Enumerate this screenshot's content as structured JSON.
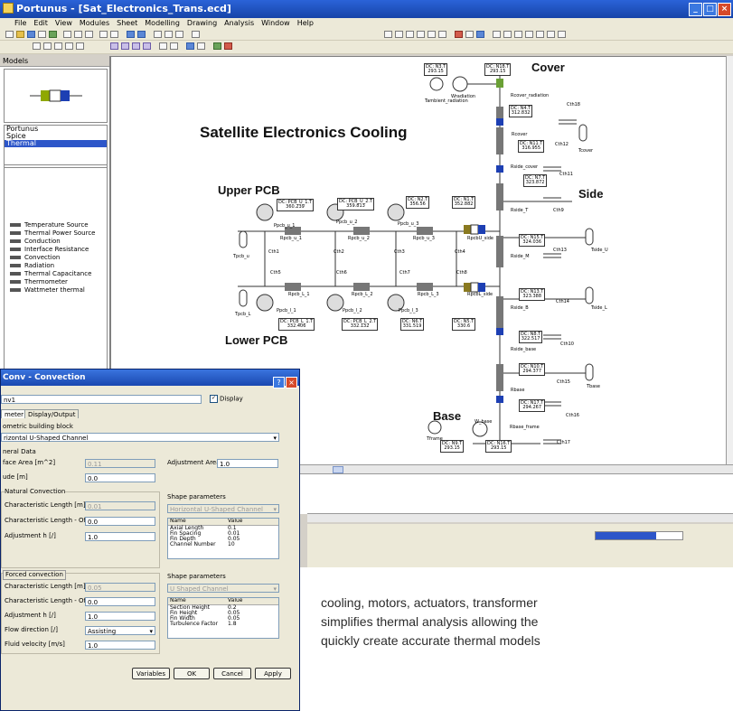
{
  "window": {
    "title": "Portunus - [Sat_Electronics_Trans.ecd]",
    "menus": [
      "File",
      "Edit",
      "View",
      "Modules",
      "Sheet",
      "Modelling",
      "Drawing",
      "Analysis",
      "Window",
      "Help"
    ]
  },
  "models_panel": {
    "header": "Models",
    "library": [
      "Portunus",
      "Spice",
      "Thermal"
    ],
    "selected_library": "Thermal",
    "elements": [
      "Temperature Source",
      "Thermal Power Source",
      "Conduction",
      "Interface Resistance",
      "Convection",
      "Radiation",
      "Thermal Capacitance",
      "Thermometer",
      "Wattmeter thermal"
    ]
  },
  "schematic": {
    "title": "Satellite Electronics Cooling",
    "sections": {
      "cover": "Cover",
      "side": "Side",
      "base": "Base",
      "upper_pcb": "Upper PCB",
      "lower_pcb": "Lower PCB"
    },
    "dc_boxes": [
      {
        "name": "DC: N3.T",
        "value": "293.15"
      },
      {
        "name": "DC: N18.T",
        "value": "293.15"
      },
      {
        "name": "DC: N4.T",
        "value": "312.832"
      },
      {
        "name": "DC: N11.T",
        "value": "316.955"
      },
      {
        "name": "DC: N7.T",
        "value": "323.872"
      },
      {
        "name": "DC: PCB_U_1.T",
        "value": "360.239"
      },
      {
        "name": "DC: PCB_U_2.T",
        "value": "359.813"
      },
      {
        "name": "DC: N2.T",
        "value": "356.56"
      },
      {
        "name": "DC: N1.T",
        "value": "352.882"
      },
      {
        "name": "DC: N15.T",
        "value": "324.036"
      },
      {
        "name": "DC: N13.T",
        "value": "323.388"
      },
      {
        "name": "DC: PCB_L_1.T",
        "value": "332.406"
      },
      {
        "name": "DC: PCB_L_2.T",
        "value": "332.132"
      },
      {
        "name": "DC: N6.T",
        "value": "331.519"
      },
      {
        "name": "DC: N5.T",
        "value": "330.6"
      },
      {
        "name": "DC: N8.T",
        "value": "322.517"
      },
      {
        "name": "DC: N10.T",
        "value": "294.377"
      },
      {
        "name": "DC: N17.T",
        "value": "294.267"
      },
      {
        "name": "DC: N9.T",
        "value": "293.15"
      },
      {
        "name": "DC: N16.T",
        "value": "293.15"
      }
    ],
    "component_labels": {
      "tambient": "Tambient_radiation",
      "wradiation": "Wradiation",
      "rcover_rad": "Rcover_radiation",
      "cth18": "Cth18",
      "rcover": "Rcover",
      "cth12": "Cth12",
      "tcover": "Tcover",
      "rside_cover": "Rside_cover",
      "cth11": "Cth11",
      "cth9": "Cth9",
      "rside_t": "Rside_T",
      "rside_m": "Rside_M",
      "cth13": "Cth13",
      "tside_u": "Tside_U",
      "cth14": "Cth14",
      "tside_l": "Tside_L",
      "rside_b": "Rside_B",
      "cth10": "Cth10",
      "rside_base": "Rside_base",
      "cth15": "Cth15",
      "tbase": "Tbase",
      "rbase": "Rbase",
      "cth16": "Cth16",
      "rbase_frame": "Rbase_frame",
      "cth17": "Cth17",
      "tframe": "Tframe",
      "w_base": "W_base",
      "ppcb_u_1": "Ppcb_u_1",
      "ppcb_u_2": "Ppcb_u_2",
      "ppcb_u_3": "Ppcb_u_3",
      "rpcb_u_1": "Rpcb_u_1",
      "rpcb_u_2": "Rpcb_u_2",
      "rpcb_u_3": "Rpcb_u_3",
      "rpcbu_side": "RpcbU_side",
      "tpcb_u": "Tpcb_u",
      "cth1": "Cth1",
      "cth2": "Cth2",
      "cth3": "Cth3",
      "cth4": "Cth4",
      "cth5": "Cth5",
      "cth6": "Cth6",
      "cth7": "Cth7",
      "cth8": "Cth8",
      "rpcb_l_1": "Rpcb_L_1",
      "rpcb_l_2": "Rpcb_L_2",
      "rpcb_l_3": "Rpcb_L_3",
      "rpcbl_side": "RpcbL_side",
      "tpcb_l": "Tpcb_L",
      "ppcb_l_1": "Ppcb_l_1",
      "ppcb_l_2": "Ppcb_l_2",
      "ppcb_l_3": "Ppcb_l_3"
    }
  },
  "dialog": {
    "title": "Conv - Convection",
    "name_value": "nv1",
    "display_label": "Display",
    "display_checked": true,
    "tabs": [
      "meter",
      "Display/Output"
    ],
    "building_block_label": "ometric building block",
    "building_block_value": "rizontal U-Shaped Channel",
    "general_data_label": "neral Data",
    "surface_area_label": "face Area [m^2]",
    "surface_area_value": "0.11",
    "adjustment_area_label": "Adjustment Area [/]",
    "adjustment_area_value": "1.0",
    "altitude_label": "ude [m]",
    "altitude_value": "0.0",
    "natural": {
      "label": "Natural Convection",
      "char_length_label": "Characteristic Length [m]",
      "char_length_value": "0.01",
      "char_offset_label": "Characteristic Length - Offset [m]",
      "char_offset_value": "0.0",
      "adjustment_label": "Adjustment h [/]",
      "adjustment_value": "1.0",
      "shape_label": "Shape parameters",
      "shape_select": "Horizontal U-Shaped Channel",
      "table_headers": [
        "Name",
        "Value"
      ],
      "rows": [
        [
          "Axial Length",
          "0.1"
        ],
        [
          "Fin Spacing",
          "0.01"
        ],
        [
          "Fin Depth",
          "0.05"
        ],
        [
          "Channel Number",
          "10"
        ]
      ]
    },
    "forced": {
      "label": "Forced convection",
      "char_length_label": "Characteristic Length [m]",
      "char_length_value": "0.05",
      "char_offset_label": "Characteristic Length - Offset [m]",
      "char_offset_value": "0.0",
      "adjustment_label": "Adjustment h [/]",
      "adjustment_value": "1.0",
      "flow_label": "Flow direction [/]",
      "flow_value": "Assisting",
      "velocity_label": "Fluid velocity [m/s]",
      "velocity_value": "1.0",
      "shape_label": "Shape parameters",
      "shape_select": "U Shaped Channel",
      "table_headers": [
        "Name",
        "Value"
      ],
      "rows": [
        [
          "Section Height",
          "0.2"
        ],
        [
          "Fin Height",
          "0.05"
        ],
        [
          "Fin Width",
          "0.05"
        ],
        [
          "Turbulence Factor",
          "1.8"
        ]
      ]
    },
    "buttons": {
      "variables": "Variables",
      "ok": "OK",
      "cancel": "Cancel",
      "apply": "Apply"
    }
  },
  "caption_lines": [
    "cooling, motors, actuators, transformer",
    "simplifies thermal analysis allowing the",
    "quickly create accurate thermal models"
  ],
  "status": {
    "progress_percent": 70
  }
}
